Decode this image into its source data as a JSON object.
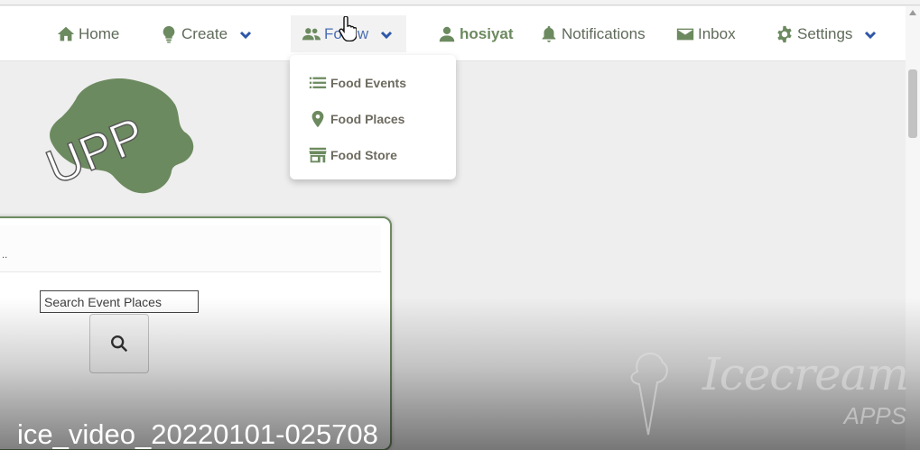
{
  "nav": {
    "home": "Home",
    "create": "Create",
    "follow": "Follow",
    "user": "hosiyat",
    "notifications": "Notifications",
    "inbox": "Inbox",
    "settings": "Settings"
  },
  "follow_menu": {
    "items": [
      {
        "label": "Food Events",
        "icon": "list-icon"
      },
      {
        "label": "Food Places",
        "icon": "map-pin-icon"
      },
      {
        "label": "Food Store",
        "icon": "store-icon"
      }
    ]
  },
  "logo": {
    "text": "UPP",
    "color": "#6c8a5f"
  },
  "card": {
    "header_text": "..",
    "search_placeholder": "Search Event Places"
  },
  "overlay": {
    "caption": "ice_video_20220101-025708",
    "watermark_brand": "Icecream",
    "watermark_sub": "APPS"
  },
  "colors": {
    "accent": "#6c8a5f",
    "link": "#2f57a8"
  }
}
